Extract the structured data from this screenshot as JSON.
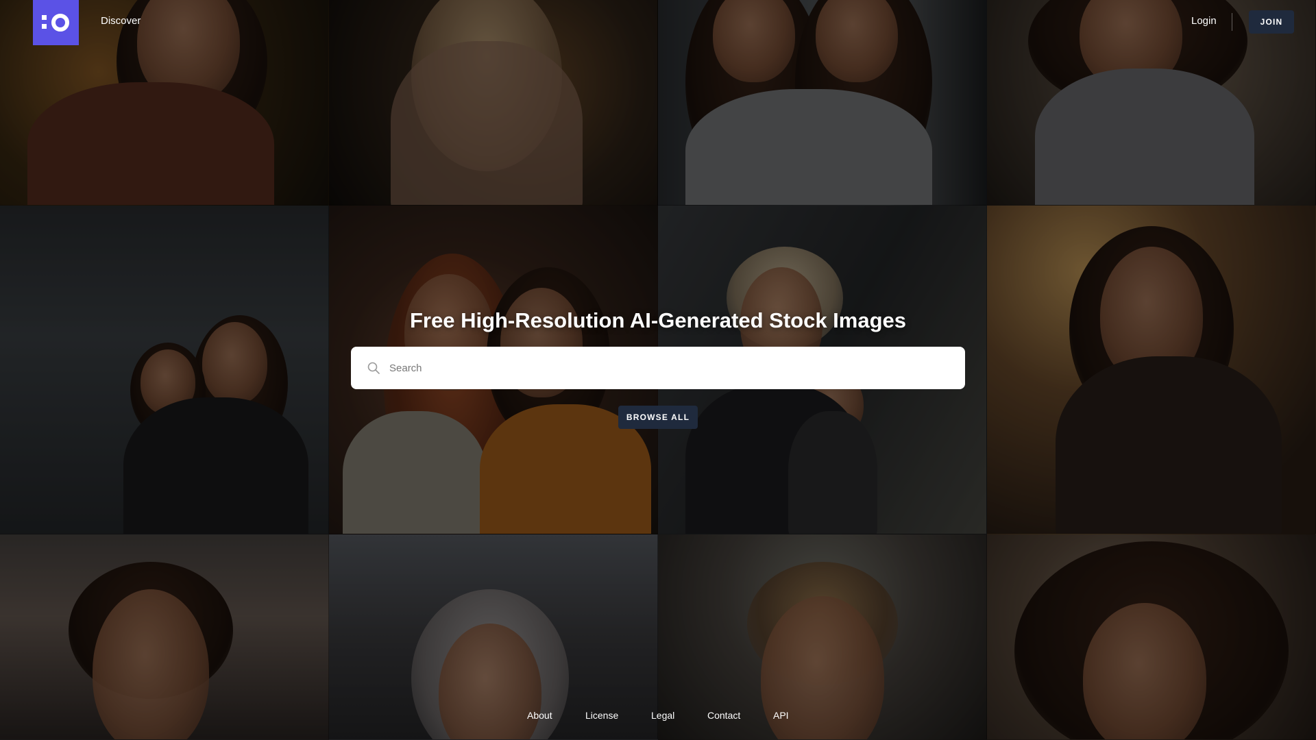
{
  "header": {
    "logo_alt": "io",
    "nav_discover": "Discover",
    "login": "Login",
    "join": "JOIN"
  },
  "hero": {
    "title": "Free High-Resolution AI-Generated Stock Images",
    "search_placeholder": "Search",
    "browse_all": "BROWSE ALL"
  },
  "footer": {
    "links": [
      "About",
      "License",
      "Legal",
      "Contact",
      "API"
    ]
  },
  "colors": {
    "brand": "#5b52e6",
    "button_dark": "#1f2a3d",
    "overlay": "rgba(0,0,0,0.45)"
  },
  "icons": {
    "logo": "io-logo-icon",
    "search": "search-icon"
  }
}
